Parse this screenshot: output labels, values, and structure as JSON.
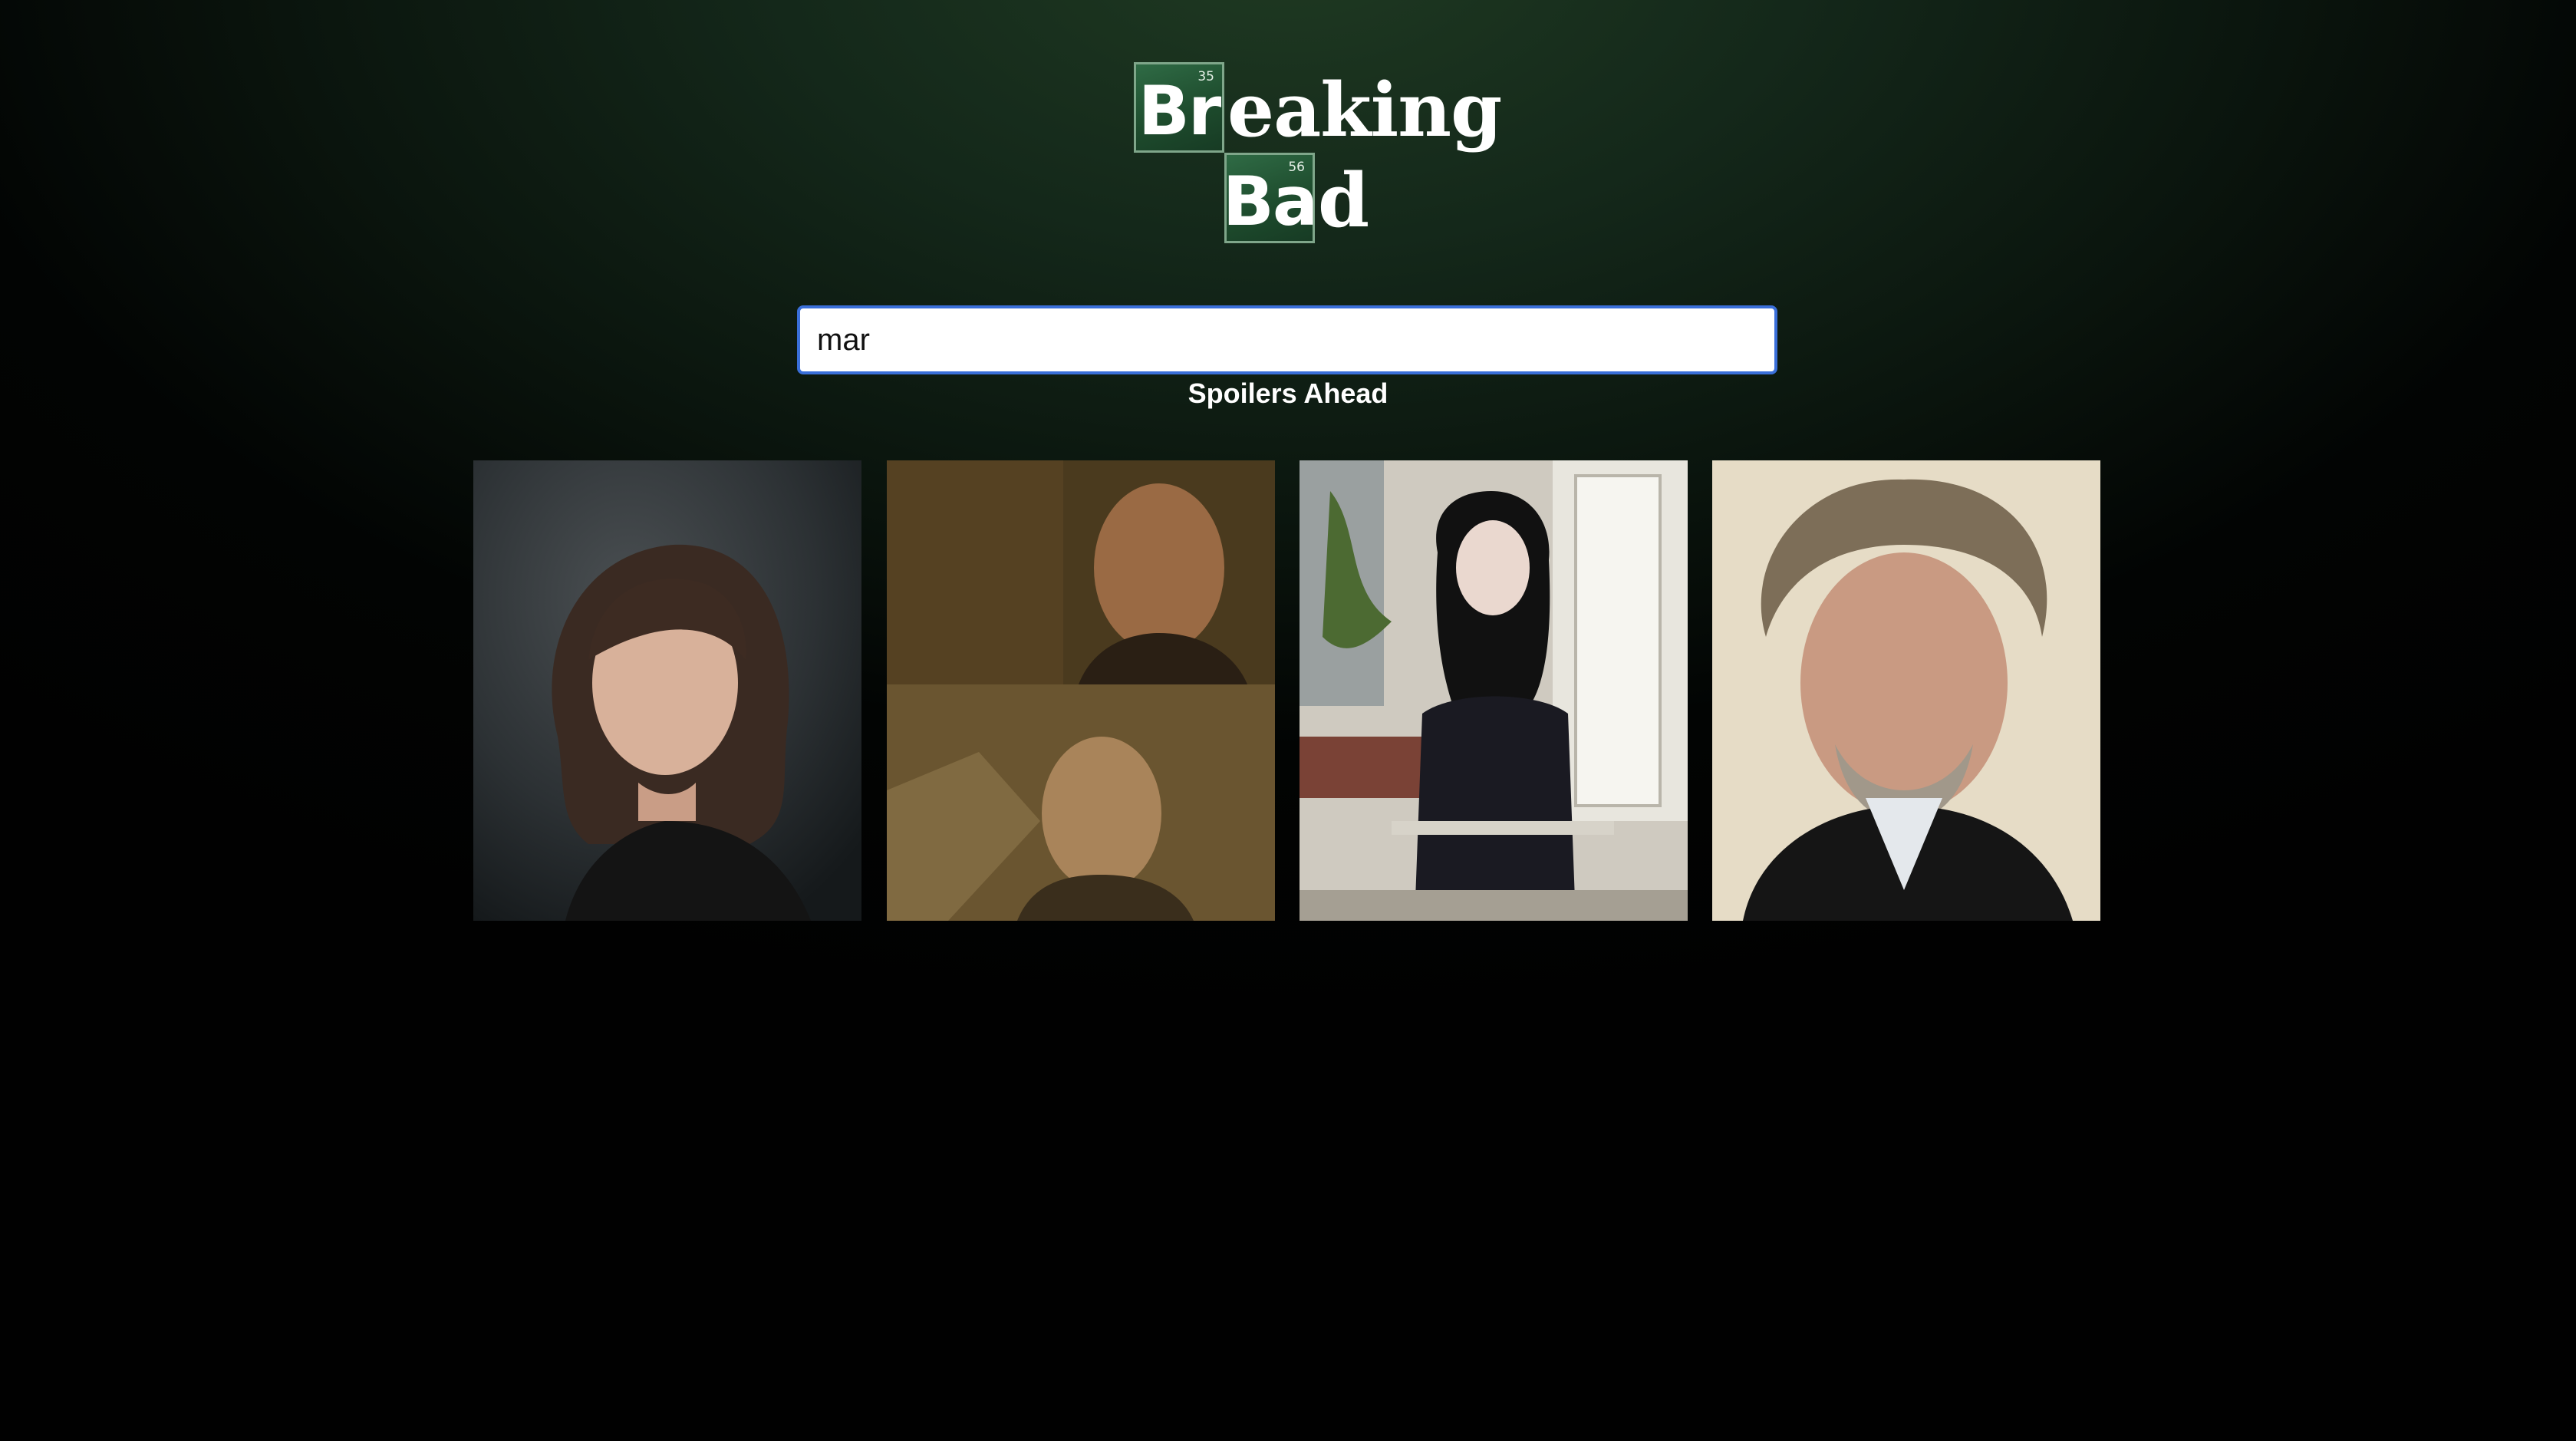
{
  "logo": {
    "row1": {
      "element_number": "35",
      "element_symbol": "Br",
      "rest": "eaking"
    },
    "row2": {
      "element_number": "56",
      "element_symbol": "Ba",
      "rest": "d"
    },
    "colors": {
      "tile": "#1d4a2c",
      "tile_border": "#7fa68a",
      "text": "#ffffff"
    }
  },
  "search": {
    "value": "mar",
    "placeholder": ""
  },
  "notice": "Spoilers Ahead",
  "characters": [
    {
      "icon": "portrait-woman-dark-hair-photo"
    },
    {
      "icon": "portrait-two-bald-men-collage-photo"
    },
    {
      "icon": "portrait-woman-black-hair-porch-photo"
    },
    {
      "icon": "portrait-man-gray-curly-hair-photo"
    }
  ],
  "colors": {
    "background_top": "#1f3a22",
    "background_bottom": "#010101",
    "search_focus_border": "#3a6fd9",
    "notice_text": "#ffffff"
  }
}
